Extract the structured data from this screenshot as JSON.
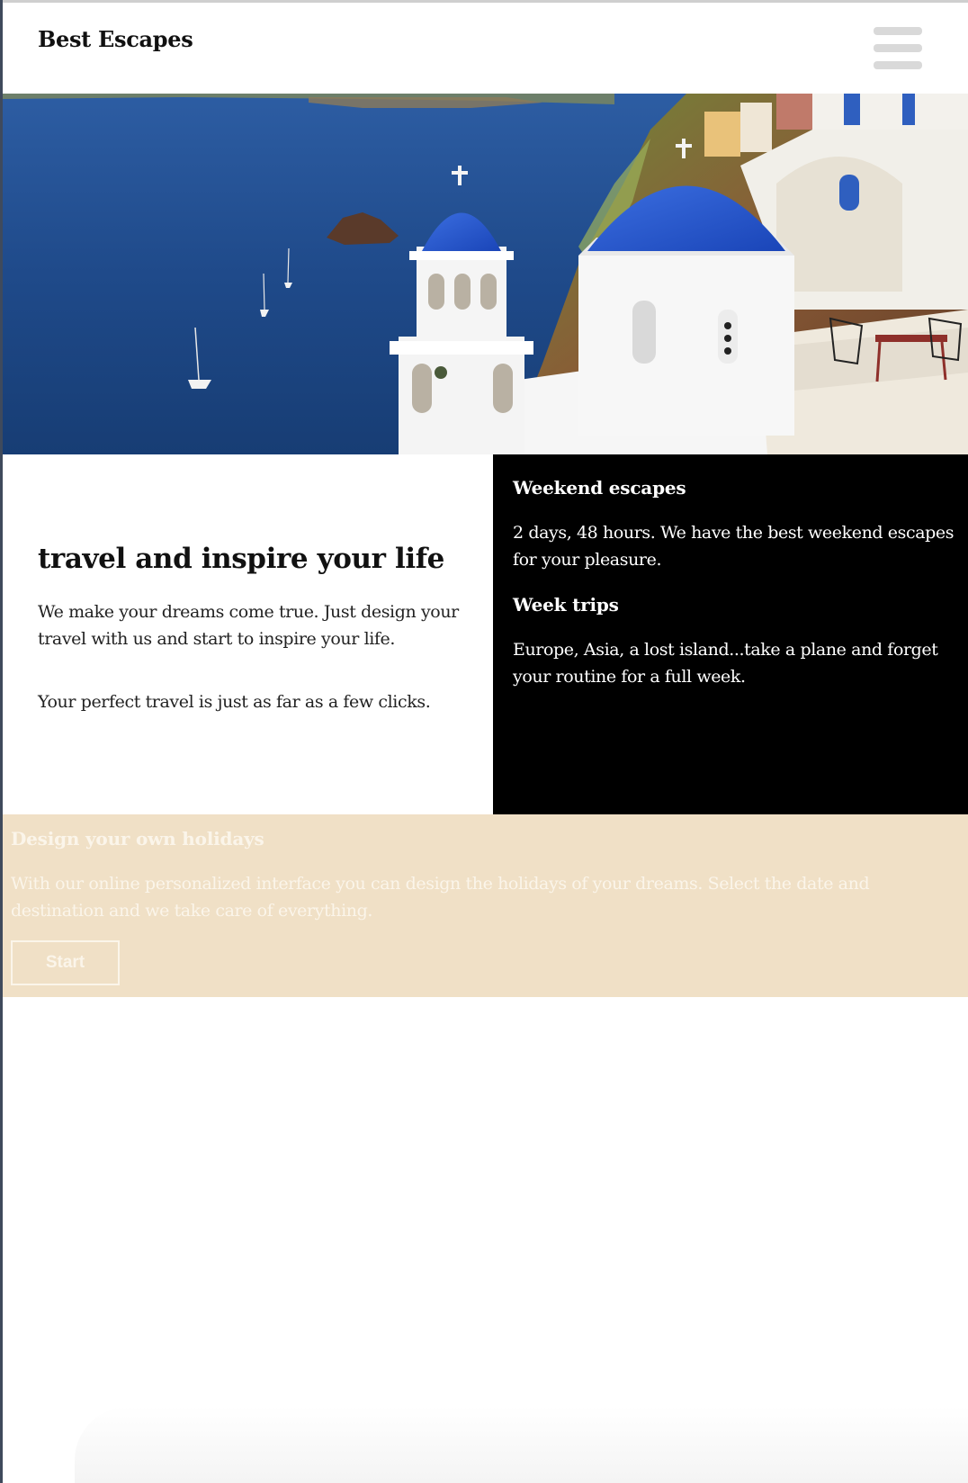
{
  "header": {
    "brand": "Best Escapes",
    "menu_icon": "hamburger-menu-icon"
  },
  "hero": {
    "image": "santorini-blue-dome-sea-view"
  },
  "intro": {
    "title": "travel and inspire your life",
    "paragraph1": "We make your dreams come true. Just design your travel with us and start to inspire your life.",
    "paragraph2": "Your perfect travel is just as far as a few clicks."
  },
  "trips": {
    "weekend": {
      "title": "Weekend escapes",
      "text": "2 days, 48 hours. We have the best weekend escapes for your pleasure."
    },
    "week": {
      "title": "Week trips",
      "text": "Europe, Asia, a lost island...take a plane and forget your routine for a full week."
    }
  },
  "design": {
    "title": "Design your own holidays",
    "text": "With our online personalized interface you can design the holidays of your dreams. Select the date and destination and we take care of everything.",
    "button_label": "Start"
  },
  "colors": {
    "trips_background": "#000000",
    "design_background": "#f0e0c6",
    "design_text": "#fbf5ea",
    "menu_bars": "#d9d9d9",
    "dome_blue": "#1f4fc4",
    "sea_blue": "#1f4a8a"
  }
}
